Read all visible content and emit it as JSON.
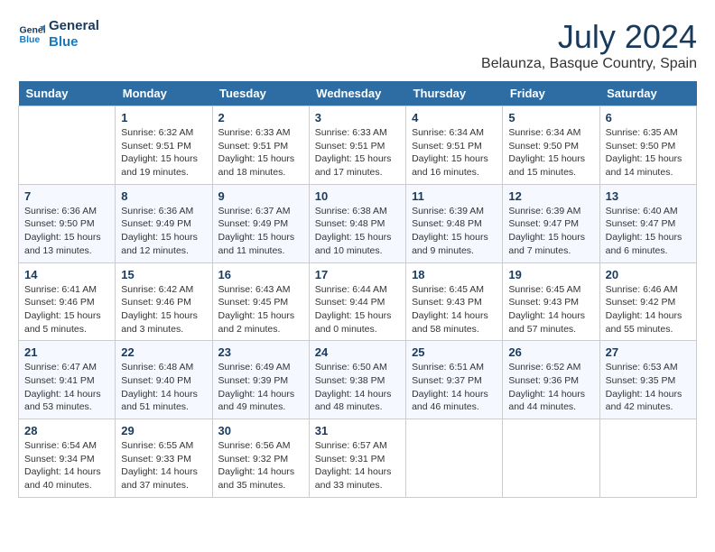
{
  "logo": {
    "line1": "General",
    "line2": "Blue"
  },
  "title": "July 2024",
  "location": "Belaunza, Basque Country, Spain",
  "days_of_week": [
    "Sunday",
    "Monday",
    "Tuesday",
    "Wednesday",
    "Thursday",
    "Friday",
    "Saturday"
  ],
  "weeks": [
    [
      {
        "day": "",
        "details": ""
      },
      {
        "day": "1",
        "details": "Sunrise: 6:32 AM\nSunset: 9:51 PM\nDaylight: 15 hours\nand 19 minutes."
      },
      {
        "day": "2",
        "details": "Sunrise: 6:33 AM\nSunset: 9:51 PM\nDaylight: 15 hours\nand 18 minutes."
      },
      {
        "day": "3",
        "details": "Sunrise: 6:33 AM\nSunset: 9:51 PM\nDaylight: 15 hours\nand 17 minutes."
      },
      {
        "day": "4",
        "details": "Sunrise: 6:34 AM\nSunset: 9:51 PM\nDaylight: 15 hours\nand 16 minutes."
      },
      {
        "day": "5",
        "details": "Sunrise: 6:34 AM\nSunset: 9:50 PM\nDaylight: 15 hours\nand 15 minutes."
      },
      {
        "day": "6",
        "details": "Sunrise: 6:35 AM\nSunset: 9:50 PM\nDaylight: 15 hours\nand 14 minutes."
      }
    ],
    [
      {
        "day": "7",
        "details": "Sunrise: 6:36 AM\nSunset: 9:50 PM\nDaylight: 15 hours\nand 13 minutes."
      },
      {
        "day": "8",
        "details": "Sunrise: 6:36 AM\nSunset: 9:49 PM\nDaylight: 15 hours\nand 12 minutes."
      },
      {
        "day": "9",
        "details": "Sunrise: 6:37 AM\nSunset: 9:49 PM\nDaylight: 15 hours\nand 11 minutes."
      },
      {
        "day": "10",
        "details": "Sunrise: 6:38 AM\nSunset: 9:48 PM\nDaylight: 15 hours\nand 10 minutes."
      },
      {
        "day": "11",
        "details": "Sunrise: 6:39 AM\nSunset: 9:48 PM\nDaylight: 15 hours\nand 9 minutes."
      },
      {
        "day": "12",
        "details": "Sunrise: 6:39 AM\nSunset: 9:47 PM\nDaylight: 15 hours\nand 7 minutes."
      },
      {
        "day": "13",
        "details": "Sunrise: 6:40 AM\nSunset: 9:47 PM\nDaylight: 15 hours\nand 6 minutes."
      }
    ],
    [
      {
        "day": "14",
        "details": "Sunrise: 6:41 AM\nSunset: 9:46 PM\nDaylight: 15 hours\nand 5 minutes."
      },
      {
        "day": "15",
        "details": "Sunrise: 6:42 AM\nSunset: 9:46 PM\nDaylight: 15 hours\nand 3 minutes."
      },
      {
        "day": "16",
        "details": "Sunrise: 6:43 AM\nSunset: 9:45 PM\nDaylight: 15 hours\nand 2 minutes."
      },
      {
        "day": "17",
        "details": "Sunrise: 6:44 AM\nSunset: 9:44 PM\nDaylight: 15 hours\nand 0 minutes."
      },
      {
        "day": "18",
        "details": "Sunrise: 6:45 AM\nSunset: 9:43 PM\nDaylight: 14 hours\nand 58 minutes."
      },
      {
        "day": "19",
        "details": "Sunrise: 6:45 AM\nSunset: 9:43 PM\nDaylight: 14 hours\nand 57 minutes."
      },
      {
        "day": "20",
        "details": "Sunrise: 6:46 AM\nSunset: 9:42 PM\nDaylight: 14 hours\nand 55 minutes."
      }
    ],
    [
      {
        "day": "21",
        "details": "Sunrise: 6:47 AM\nSunset: 9:41 PM\nDaylight: 14 hours\nand 53 minutes."
      },
      {
        "day": "22",
        "details": "Sunrise: 6:48 AM\nSunset: 9:40 PM\nDaylight: 14 hours\nand 51 minutes."
      },
      {
        "day": "23",
        "details": "Sunrise: 6:49 AM\nSunset: 9:39 PM\nDaylight: 14 hours\nand 49 minutes."
      },
      {
        "day": "24",
        "details": "Sunrise: 6:50 AM\nSunset: 9:38 PM\nDaylight: 14 hours\nand 48 minutes."
      },
      {
        "day": "25",
        "details": "Sunrise: 6:51 AM\nSunset: 9:37 PM\nDaylight: 14 hours\nand 46 minutes."
      },
      {
        "day": "26",
        "details": "Sunrise: 6:52 AM\nSunset: 9:36 PM\nDaylight: 14 hours\nand 44 minutes."
      },
      {
        "day": "27",
        "details": "Sunrise: 6:53 AM\nSunset: 9:35 PM\nDaylight: 14 hours\nand 42 minutes."
      }
    ],
    [
      {
        "day": "28",
        "details": "Sunrise: 6:54 AM\nSunset: 9:34 PM\nDaylight: 14 hours\nand 40 minutes."
      },
      {
        "day": "29",
        "details": "Sunrise: 6:55 AM\nSunset: 9:33 PM\nDaylight: 14 hours\nand 37 minutes."
      },
      {
        "day": "30",
        "details": "Sunrise: 6:56 AM\nSunset: 9:32 PM\nDaylight: 14 hours\nand 35 minutes."
      },
      {
        "day": "31",
        "details": "Sunrise: 6:57 AM\nSunset: 9:31 PM\nDaylight: 14 hours\nand 33 minutes."
      },
      {
        "day": "",
        "details": ""
      },
      {
        "day": "",
        "details": ""
      },
      {
        "day": "",
        "details": ""
      }
    ]
  ]
}
